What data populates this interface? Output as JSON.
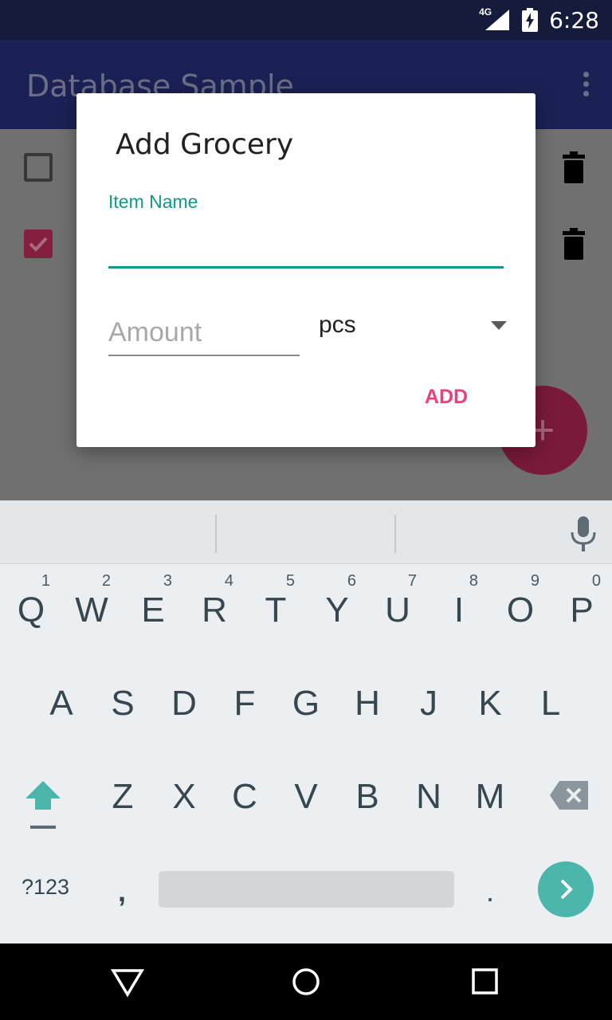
{
  "status_bar": {
    "network": "4G",
    "time": "6:28"
  },
  "app_bar": {
    "title": "Database Sample",
    "overflow_icon": "more-vert-icon"
  },
  "list": {
    "items": [
      {
        "checked": false,
        "delete_icon": "trash-icon"
      },
      {
        "checked": true,
        "delete_icon": "trash-icon"
      }
    ],
    "fab_label": "+"
  },
  "dialog": {
    "title": "Add Grocery",
    "item_name_label": "Item Name",
    "item_name_value": "",
    "amount_placeholder": "Amount",
    "unit_selected": "pcs",
    "add_label": "ADD"
  },
  "keyboard": {
    "row1": [
      {
        "key": "Q",
        "hint": "1"
      },
      {
        "key": "W",
        "hint": "2"
      },
      {
        "key": "E",
        "hint": "3"
      },
      {
        "key": "R",
        "hint": "4"
      },
      {
        "key": "T",
        "hint": "5"
      },
      {
        "key": "Y",
        "hint": "6"
      },
      {
        "key": "U",
        "hint": "7"
      },
      {
        "key": "I",
        "hint": "8"
      },
      {
        "key": "O",
        "hint": "9"
      },
      {
        "key": "P",
        "hint": "0"
      }
    ],
    "row2": [
      "A",
      "S",
      "D",
      "F",
      "G",
      "H",
      "J",
      "K",
      "L"
    ],
    "row3": [
      "Z",
      "X",
      "C",
      "V",
      "B",
      "N",
      "M"
    ],
    "symbols_label": "?123",
    "comma": ",",
    "period": "."
  },
  "colors": {
    "accent": "#139787",
    "pink": "#ec407a",
    "primary_dark": "#151b3a"
  }
}
